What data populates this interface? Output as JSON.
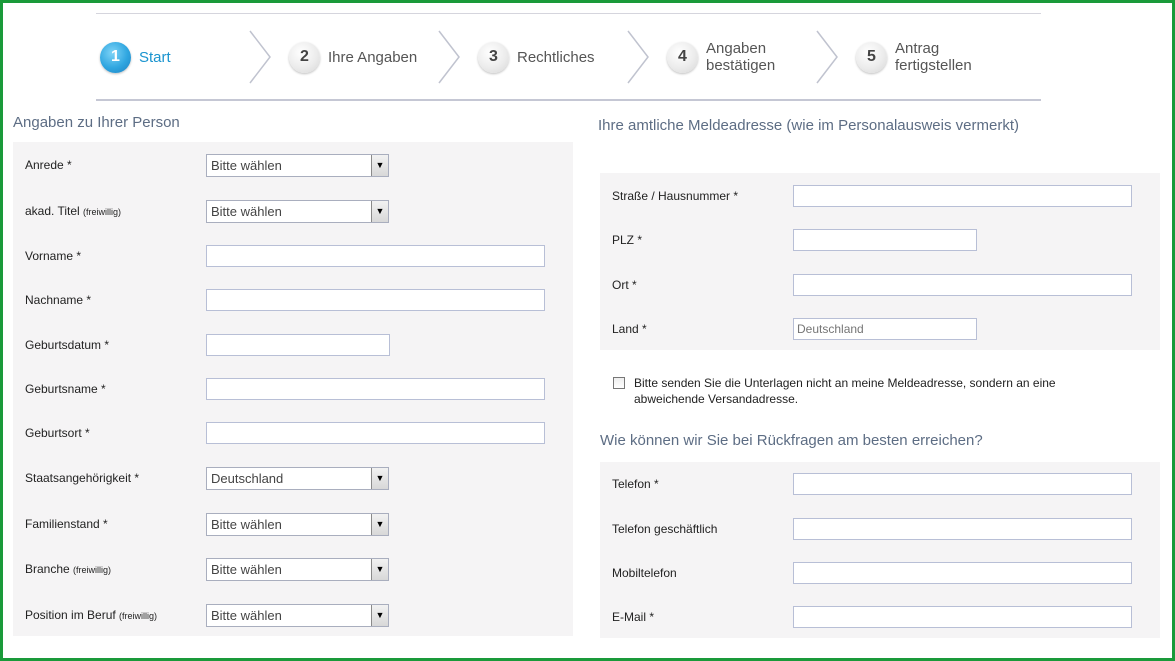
{
  "steps": [
    {
      "num": "1",
      "label": "Start"
    },
    {
      "num": "2",
      "label": "Ihre Angaben"
    },
    {
      "num": "3",
      "label": "Rechtliches"
    },
    {
      "num": "4",
      "label_line1": "Angaben",
      "label_line2": "bestätigen"
    },
    {
      "num": "5",
      "label_line1": "Antrag",
      "label_line2": "fertigstellen"
    }
  ],
  "person": {
    "title": "Angaben zu Ihrer Person",
    "anrede": {
      "label": "Anrede  *",
      "value": "Bitte wählen"
    },
    "titel": {
      "label": "akad. Titel",
      "note": "(freiwillig)",
      "value": "Bitte wählen"
    },
    "vorname": {
      "label": "Vorname  *"
    },
    "nachname": {
      "label": "Nachname  *"
    },
    "geburtsdatum": {
      "label": "Geburtsdatum  *"
    },
    "geburtsname": {
      "label": "Geburtsname  *"
    },
    "geburtsort": {
      "label": "Geburtsort  *"
    },
    "staat": {
      "label": "Staatsangehörigkeit  *",
      "value": "Deutschland"
    },
    "familienstand": {
      "label": "Familienstand  *",
      "value": "Bitte wählen"
    },
    "branche": {
      "label": "Branche",
      "note": "(freiwillig)",
      "value": "Bitte wählen"
    },
    "position": {
      "label": "Position im Beruf",
      "note": "(freiwillig)",
      "value": "Bitte wählen"
    }
  },
  "address": {
    "title": "Ihre amtliche Meldeadresse (wie im Personalausweis vermerkt)",
    "strasse": {
      "label": "Straße / Hausnummer  *"
    },
    "plz": {
      "label": "PLZ  *"
    },
    "ort": {
      "label": "Ort  *"
    },
    "land": {
      "label": "Land  *",
      "value": "Deutschland"
    },
    "checkbox_line1": "Bitte senden Sie die Unterlagen nicht an meine Meldeadresse, sondern an eine",
    "checkbox_line2": "abweichende Versandadresse."
  },
  "contact": {
    "title": "Wie können wir Sie bei Rückfragen am besten erreichen?",
    "telefon": {
      "label": "Telefon *"
    },
    "telefon_geschaeftlich": {
      "label": "Telefon geschäftlich"
    },
    "mobil": {
      "label": "Mobiltelefon"
    },
    "email": {
      "label": "E-Mail *"
    }
  }
}
